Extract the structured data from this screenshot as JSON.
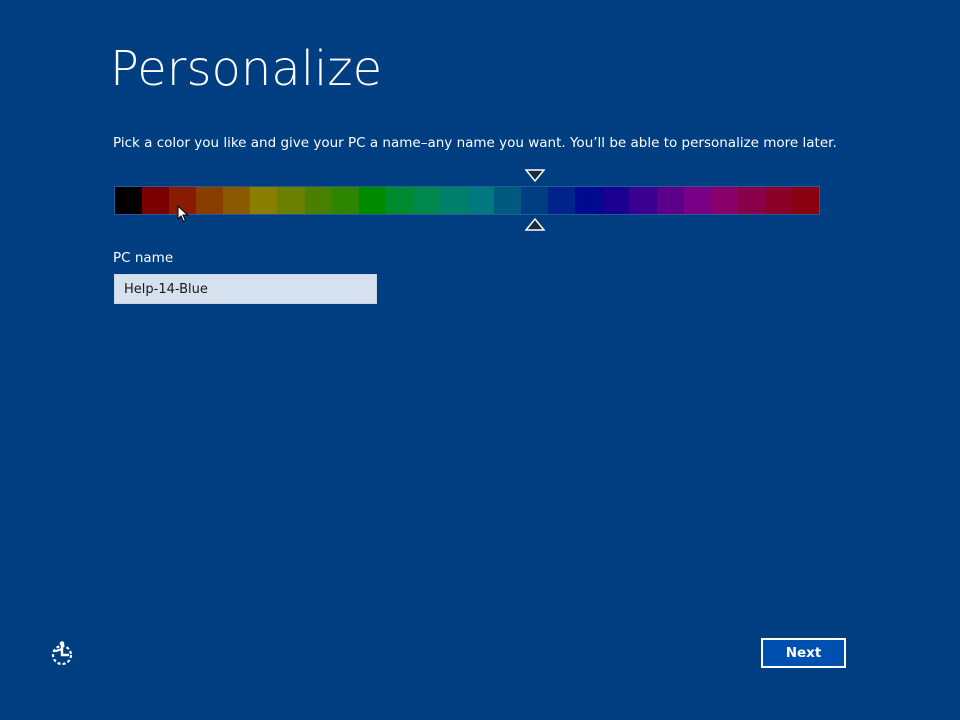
{
  "header": {
    "title": "Personalize",
    "instruction": "Pick a color you like and give your PC a name–any name you want. You’ll be able to personalize more later."
  },
  "palette": {
    "selected_index": 15,
    "colors": [
      "#000000",
      "#7a0000",
      "#8a1a00",
      "#8a3d00",
      "#8a5a00",
      "#8a7e00",
      "#6b8000",
      "#4a8000",
      "#2e8500",
      "#008a00",
      "#008a2e",
      "#00874d",
      "#00806a",
      "#00797e",
      "#005a80",
      "#003e82",
      "#00248a",
      "#000a90",
      "#1a0090",
      "#3a0090",
      "#5c008a",
      "#7a0087",
      "#8a006a",
      "#8a0048",
      "#8a0028",
      "#8a0010"
    ]
  },
  "pc_name": {
    "label": "PC name",
    "value": "Help-14-Blue"
  },
  "footer": {
    "next_label": "Next",
    "ease_icon": "ease-of-access-icon"
  },
  "colors": {
    "background": "#003e82",
    "input_background": "#d5e1ee"
  }
}
